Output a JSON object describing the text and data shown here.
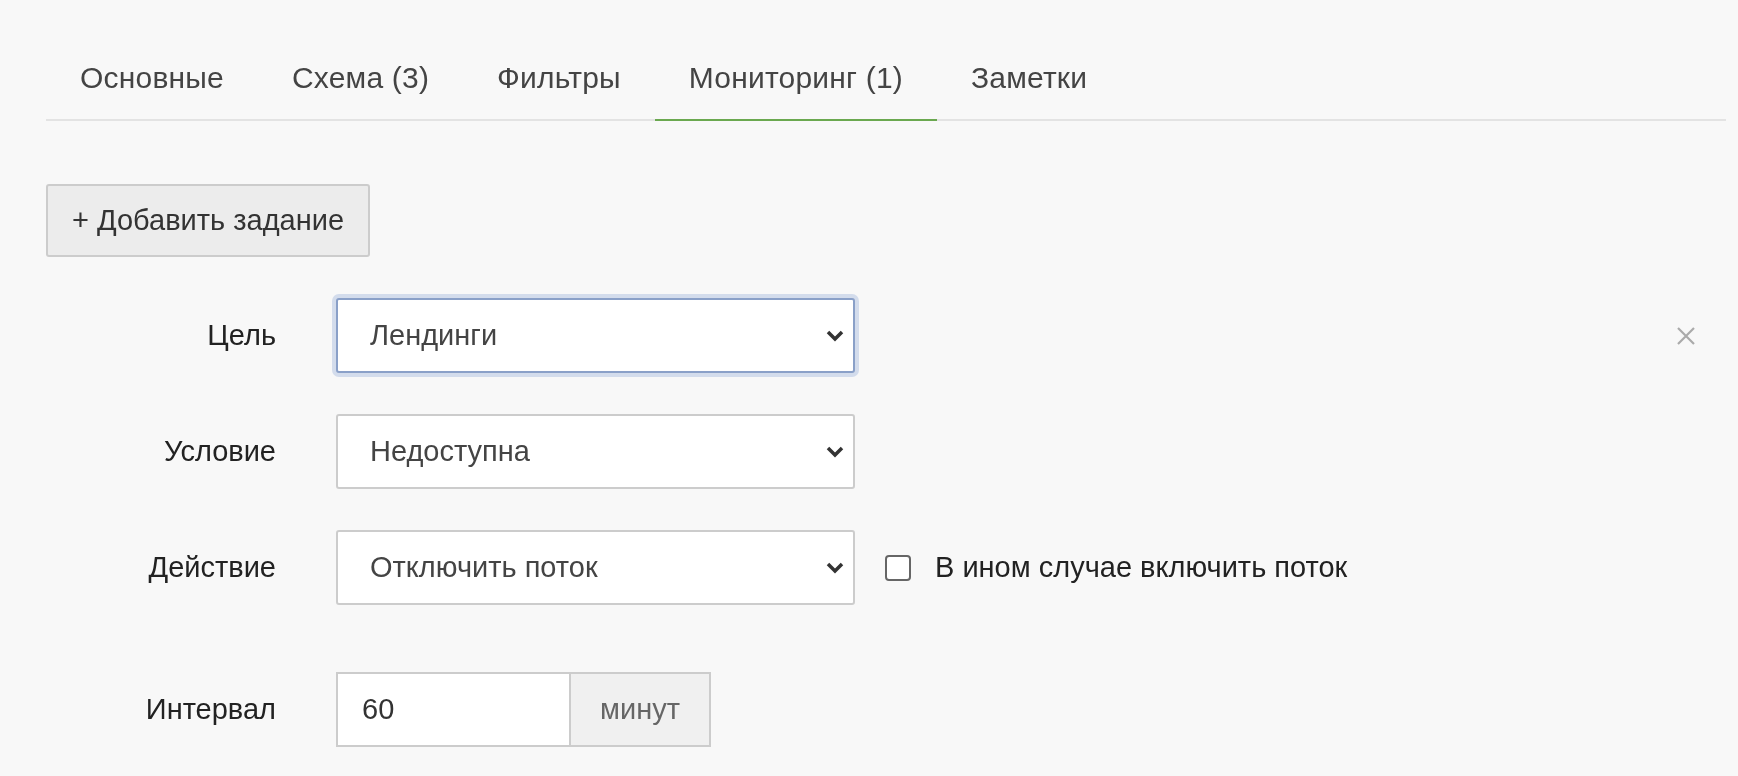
{
  "tabs": [
    {
      "label": "Основные",
      "selected": false
    },
    {
      "label": "Схема (3)",
      "selected": false
    },
    {
      "label": "Фильтры",
      "selected": false
    },
    {
      "label": "Мониторинг (1)",
      "selected": true
    },
    {
      "label": "Заметки",
      "selected": false
    }
  ],
  "add_button": "+ Добавить задание",
  "task": {
    "fields": [
      {
        "kind": "select",
        "label": "Цель",
        "value": "Лендинги",
        "focused": true
      },
      {
        "kind": "select",
        "label": "Условие",
        "value": "Недоступна",
        "focused": false
      },
      {
        "kind": "select",
        "label": "Действие",
        "value": "Отключить поток",
        "focused": false,
        "checkbox": {
          "label": "В ином случае включить поток",
          "checked": false
        }
      },
      {
        "kind": "number",
        "label": "Интервал",
        "value": "60",
        "unit": "минут"
      }
    ]
  }
}
